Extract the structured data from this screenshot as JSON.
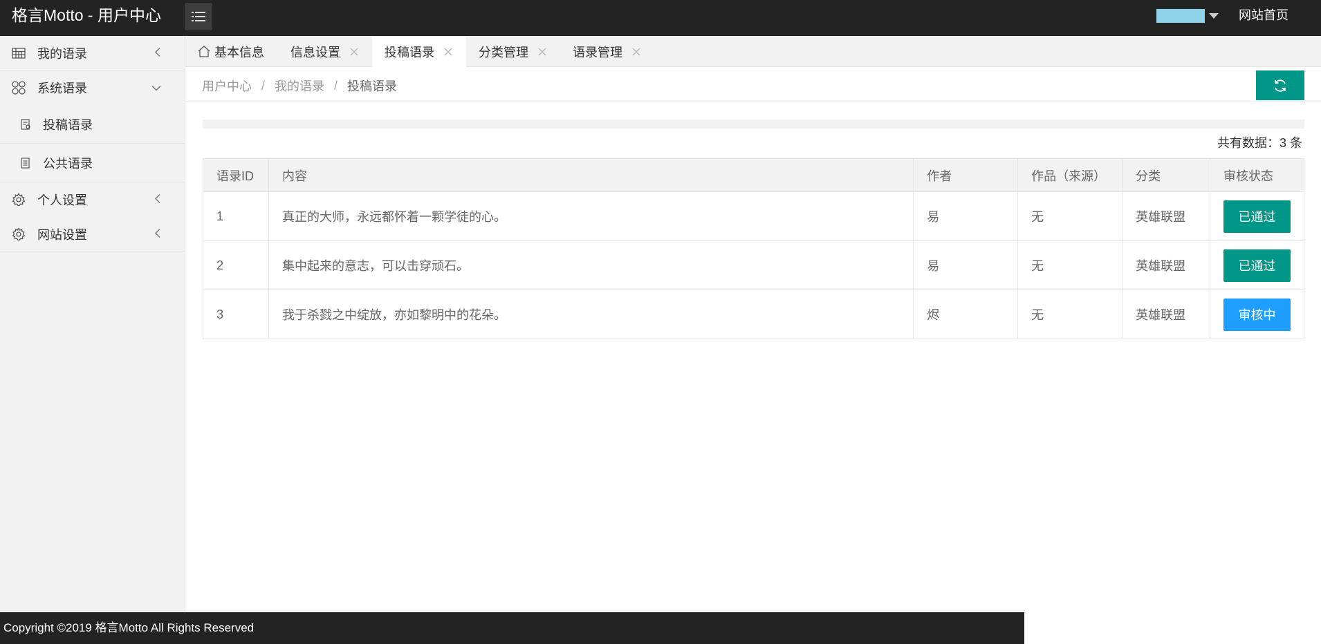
{
  "header": {
    "logo": "格言Motto - 用户中心",
    "user_name": "",
    "home_link": "网站首页"
  },
  "sidebar": {
    "items": [
      {
        "label": "我的语录",
        "icon": "table-icon"
      },
      {
        "label": "系统语录",
        "icon": "apps-icon"
      },
      {
        "label": "投稿语录",
        "icon": "doc-edit-icon"
      },
      {
        "label": "公共语录",
        "icon": "doc-icon"
      },
      {
        "label": "个人设置",
        "icon": "gear-icon"
      },
      {
        "label": "网站设置",
        "icon": "gear-icon"
      }
    ]
  },
  "tabs": [
    {
      "label": "基本信息"
    },
    {
      "label": "信息设置"
    },
    {
      "label": "投稿语录"
    },
    {
      "label": "分类管理"
    },
    {
      "label": "语录管理"
    }
  ],
  "breadcrumb": {
    "items": [
      "用户中心",
      "我的语录",
      "投稿语录"
    ],
    "separator": "/"
  },
  "summary": {
    "total": "共有数据：3 条"
  },
  "table": {
    "headers": [
      "语录ID",
      "内容",
      "作者",
      "作品（来源）",
      "分类",
      "审核状态"
    ],
    "rows": [
      {
        "id": "1",
        "content": "真正的大师，永远都怀着一颗学徒的心。",
        "author": "易",
        "work": "无",
        "category": "英雄联盟",
        "status": "已通过",
        "status_color": "#009688"
      },
      {
        "id": "2",
        "content": "集中起来的意志，可以击穿顽石。",
        "author": "易",
        "work": "无",
        "category": "英雄联盟",
        "status": "已通过",
        "status_color": "#009688"
      },
      {
        "id": "3",
        "content": "我于杀戮之中绽放，亦如黎明中的花朵。",
        "author": "烬",
        "work": "无",
        "category": "英雄联盟",
        "status": "审核中",
        "status_color": "#1e9fff"
      }
    ]
  },
  "footer": {
    "copyright": "Copyright ©2019 格言Motto All Rights Reserved"
  },
  "colors": {
    "header_bg": "#232323",
    "accent": "#009688",
    "pending": "#1e9fff"
  }
}
